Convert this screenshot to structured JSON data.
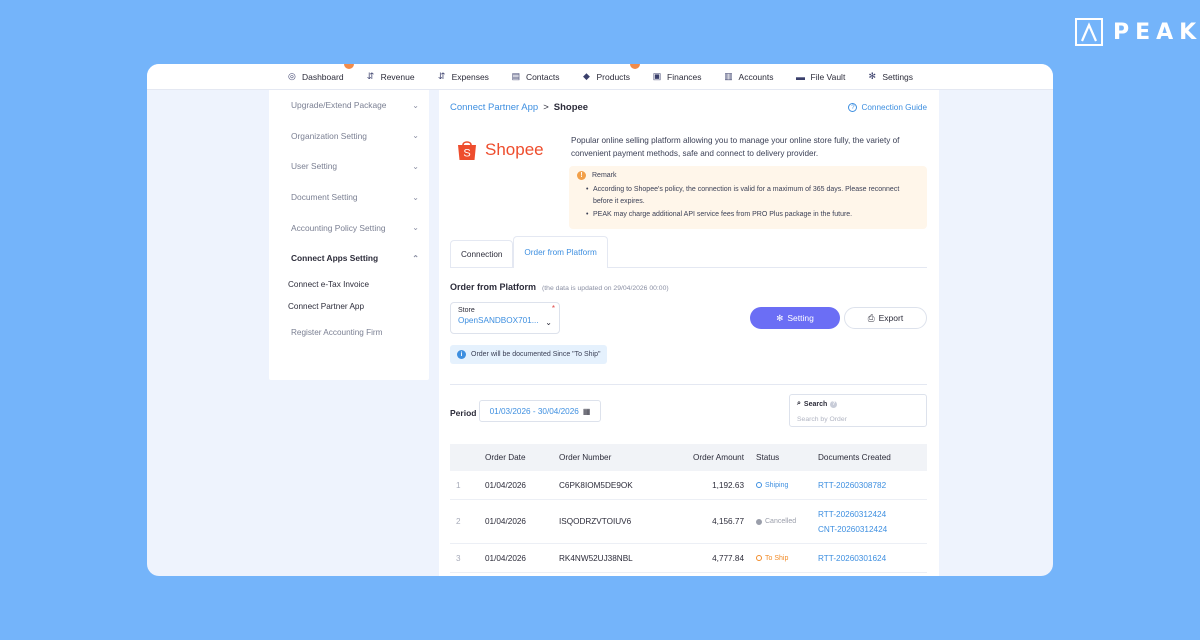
{
  "brand": {
    "name": "PEAK",
    "logo_icon": "peak-logo-icon"
  },
  "nav": [
    {
      "label": "Dashboard",
      "icon": "dashboard-icon",
      "glyph": "◎",
      "badge": true
    },
    {
      "label": "Revenue",
      "icon": "revenue-icon",
      "glyph": "⇵",
      "badge": false
    },
    {
      "label": "Expenses",
      "icon": "expenses-icon",
      "glyph": "⇵",
      "badge": false
    },
    {
      "label": "Contacts",
      "icon": "contacts-icon",
      "glyph": "▤",
      "badge": false
    },
    {
      "label": "Products",
      "icon": "products-icon",
      "glyph": "◆",
      "badge": true
    },
    {
      "label": "Finances",
      "icon": "finances-icon",
      "glyph": "▣",
      "badge": false
    },
    {
      "label": "Accounts",
      "icon": "accounts-icon",
      "glyph": "▥",
      "badge": false
    },
    {
      "label": "File Vault",
      "icon": "folder-icon",
      "glyph": "▬",
      "badge": false
    },
    {
      "label": "Settings",
      "icon": "gear-icon",
      "glyph": "✻",
      "badge": false
    }
  ],
  "sidebar": {
    "items": [
      {
        "label": "Upgrade/Extend Package",
        "chevron": "⌄"
      },
      {
        "label": "Organization Setting",
        "chevron": "⌄"
      },
      {
        "label": "User Setting",
        "chevron": "⌄"
      },
      {
        "label": "Document Setting",
        "chevron": "⌄"
      },
      {
        "label": "Accounting Policy Setting",
        "chevron": "⌄"
      },
      {
        "label": "Connect Apps Setting",
        "chevron": "⌃"
      }
    ],
    "subitems": [
      "Connect e-Tax Invoice",
      "Connect Partner App"
    ],
    "footer_item": "Register Accounting Firm"
  },
  "breadcrumb": {
    "parent": "Connect Partner App",
    "separator": ">",
    "current": "Shopee"
  },
  "guide_link": "Connection Guide",
  "partner": {
    "name": "Shopee",
    "description": "Popular online selling platform allowing you to manage your online store fully, the variety of convenient payment methods, safe and connect to delivery provider."
  },
  "remark": {
    "title": "Remark",
    "items": [
      "According to Shopee's policy, the connection is valid for a maximum of 365 days. Please reconnect before it expires.",
      "PEAK may charge additional API service fees from PRO Plus package in the future."
    ]
  },
  "tabs": [
    "Connection",
    "Order from Platform"
  ],
  "section": {
    "title": "Order from Platform",
    "note": "(the data is updated on 29/04/2026 00:00)"
  },
  "store": {
    "label": "Store",
    "value": "OpenSANDBOX701...",
    "required_mark": "*"
  },
  "buttons": {
    "setting": "Setting",
    "export": "Export"
  },
  "info_chip": "Order will be documented Since \"To Ship\"",
  "period": {
    "label": "Period",
    "value": "01/03/2026 - 30/04/2026"
  },
  "search": {
    "label": "Search",
    "placeholder": "Search by Order"
  },
  "table": {
    "headers": {
      "date": "Order Date",
      "number": "Order Number",
      "amount": "Order Amount",
      "status": "Status",
      "docs": "Documents Created"
    },
    "rows": [
      {
        "no": "1",
        "date": "01/04/2026",
        "number": "C6PK8IOM5DE9OK",
        "amount": "1,192.63",
        "status": "Shiping",
        "status_color": "#3e8fe0",
        "status_fill": false,
        "docs": [
          "RTT-20260308782"
        ]
      },
      {
        "no": "2",
        "date": "01/04/2026",
        "number": "ISQODRZVTOIUV6",
        "amount": "4,156.77",
        "status": "Cancelled",
        "status_color": "#9a9eaa",
        "status_fill": true,
        "docs": [
          "RTT-20260312424",
          "CNT-20260312424"
        ]
      },
      {
        "no": "3",
        "date": "01/04/2026",
        "number": "RK4NW52UJ38NBL",
        "amount": "4,777.84",
        "status": "To Ship",
        "status_color": "#f28c2a",
        "status_fill": false,
        "docs": [
          "RTT-20260301624"
        ]
      }
    ]
  },
  "colors": {
    "background": "#74b4fa",
    "accent": "#3e8fe0",
    "primary_button": "#6b6ef5",
    "shopee": "#ee4d2d"
  }
}
